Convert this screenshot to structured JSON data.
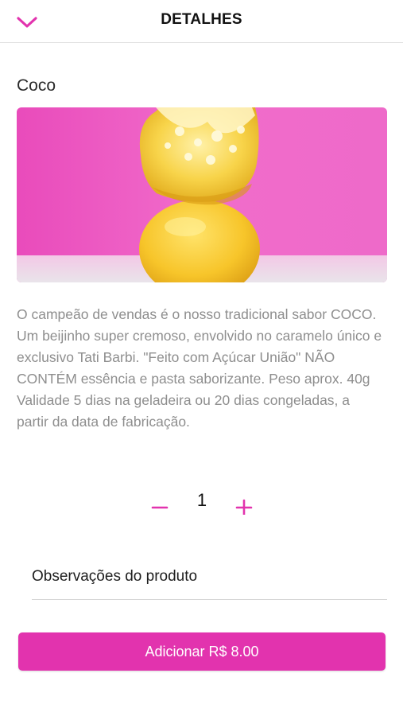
{
  "header": {
    "title": "DETALHES",
    "back_icon": "chevron-down-icon"
  },
  "product": {
    "name": "Coco",
    "image_icon": "product-photo",
    "description": "O campeão de vendas é o nosso tradicional sabor COCO. Um beijinho super cremoso, envolvido no caramelo único e exclusivo Tati Barbi. \"Feito com Açúcar União\" NÃO CONTÉM essência e pasta saborizante. Peso aprox. 40g Validade 5 dias na geladeira ou 20 dias congeladas, a partir da data de fabricação."
  },
  "quantity": {
    "value": "1",
    "minus_icon": "minus-icon",
    "plus_icon": "plus-icon"
  },
  "notes": {
    "label": "Observações do produto"
  },
  "add_button": {
    "label": "Adicionar R$ 8.00"
  },
  "colors": {
    "accent": "#e233ae",
    "image_background": "#ee5fc4",
    "text_muted": "#8e8e8e"
  }
}
